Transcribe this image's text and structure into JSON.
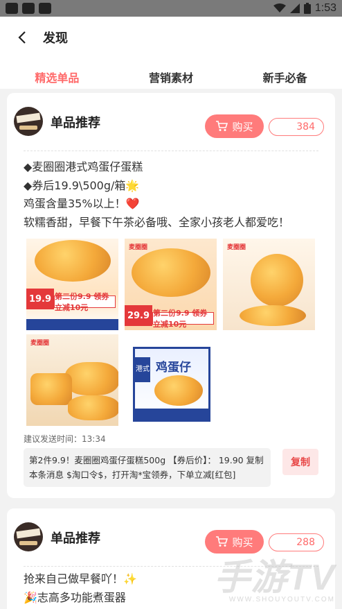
{
  "status_bar": {
    "time": "1:53"
  },
  "header": {
    "title": "发现"
  },
  "tabs": [
    {
      "label": "精选单品",
      "active": true
    },
    {
      "label": "营销素材",
      "active": false
    },
    {
      "label": "新手必备",
      "active": false
    }
  ],
  "accent_color": "#ff6a6a",
  "cards": [
    {
      "title": "单品推荐",
      "buy_label": "购买",
      "count": "384",
      "description": [
        "◆麦圈圈港式鸡蛋仔蛋糕",
        "◆券后19.9\\500g/箱🌟",
        "鸡蛋含量35%以上！❤️",
        "软糯香甜，早餐下午茶必备哦、全家小孩老人都爱吃！"
      ],
      "images": {
        "img1": {
          "price": "19.9",
          "promo": "第二份9.9 领券立减10元"
        },
        "img2": {
          "logo": "麦圈圈",
          "price": "29.9",
          "promo": "第二份9.9 领券立减10元"
        },
        "img3": {
          "logo": "麦圈圈"
        },
        "img4": {
          "logo": "麦圈圈"
        },
        "img5": {
          "title": "鸡蛋仔",
          "side_text": "港式"
        }
      },
      "suggest_time": "建议发送时间：13:34",
      "copy_text": "第2件9.9！麦圈圈鸡蛋仔蛋糕500g 【券后价】： 19.90 复制本条消息 $淘口令$，打开淘*宝领券，下单立减[红包]",
      "copy_label": "复制"
    },
    {
      "title": "单品推荐",
      "buy_label": "购买",
      "count": "288",
      "description": [
        "抢来自己做早餐吖！✨",
        "🎉志高多功能煮蛋器"
      ]
    }
  ],
  "watermark": {
    "main": "手游TV",
    "sub": "WWW.SHOUYOUTV.COM"
  }
}
